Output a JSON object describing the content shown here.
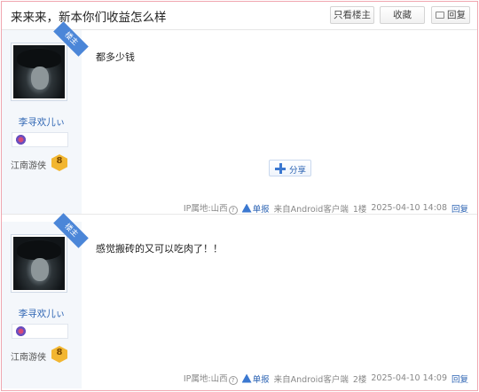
{
  "header": {
    "title": "来来来，新本你们收益怎么样",
    "only_host_label": "只看楼主",
    "favorite_label": "收藏",
    "reply_label": "回复"
  },
  "posts": [
    {
      "host_badge": "楼主",
      "username": "李寻欢儿ぃ",
      "level_name": "江南游侠",
      "level_num": "8",
      "content": "都多少钱",
      "share_label": "分享",
      "ip_label": "IP属地:山西",
      "report_label": "单报",
      "source": "来自Android客户端",
      "floor": "1楼",
      "time": "2025-04-10 14:08",
      "reply_label": "回复"
    },
    {
      "host_badge": "楼主",
      "username": "李寻欢儿ぃ",
      "level_name": "江南游侠",
      "level_num": "8",
      "content": "感觉搬砖的又可以吃肉了！！",
      "ip_label": "IP属地:山西",
      "report_label": "单报",
      "source": "来自Android客户端",
      "floor": "2楼",
      "time": "2025-04-10 14:09",
      "reply_label": "回复"
    }
  ],
  "colors": {
    "link": "#2d64b3",
    "host_badge": "#4b86d8",
    "sidebar_bg": "#f4f7fb",
    "frame_border": "#f0a7b0"
  },
  "icons": [
    "reply-icon",
    "question-icon",
    "report-icon",
    "share-plus-icon",
    "medal-icon",
    "level-badge-icon"
  ]
}
